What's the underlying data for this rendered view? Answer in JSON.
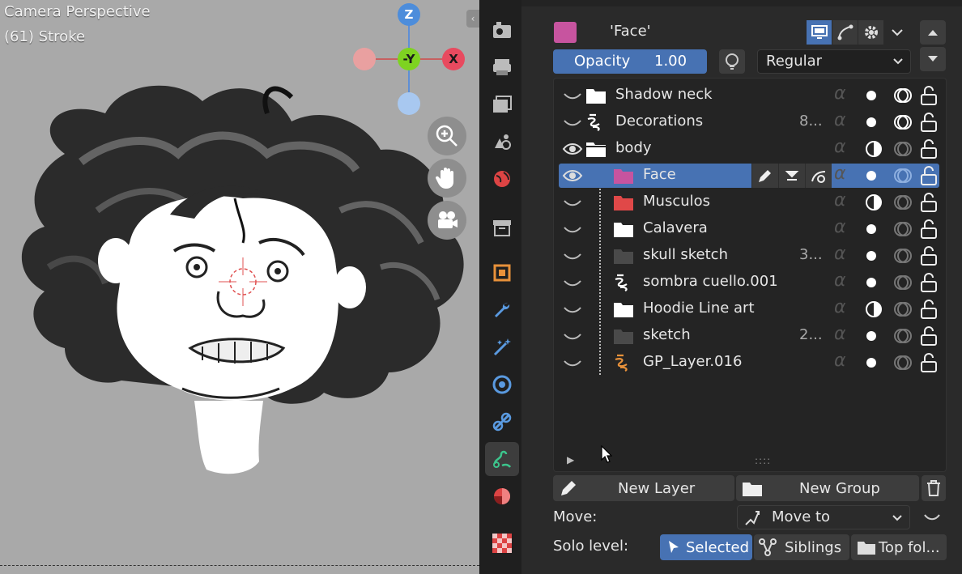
{
  "viewport": {
    "camera_title": "Camera Perspective",
    "frame_info": "(61) Stroke",
    "gizmo": {
      "z": "Z",
      "y": "-Y",
      "x": "X"
    },
    "nav_icons": [
      "zoom-in-icon",
      "hand-pan-icon",
      "camera-view-icon"
    ]
  },
  "tabs": [
    "render-icon",
    "output-icon",
    "view-layer-icon",
    "scene-icon",
    "world-icon",
    "collection-icon",
    "object-icon",
    "modifiers-icon",
    "shader-effects-icon",
    "physics-icon",
    "constraints-icon",
    "object-data-icon",
    "material-icon",
    "texture-icon"
  ],
  "active_tab": "object-data-icon",
  "panel": {
    "header_name": "'Face'",
    "opacity_label": "Opacity",
    "opacity_value": "1.00",
    "blend_mode": "Regular",
    "layers": [
      {
        "name": "Shadow neck",
        "ext": "",
        "type": "folder-white",
        "visible": false,
        "indent": 0
      },
      {
        "name": "Decorations",
        "ext": "8...",
        "type": "stroke-white",
        "visible": false,
        "indent": 0
      },
      {
        "name": "body",
        "ext": "",
        "type": "folder-open-white",
        "visible": true,
        "indent": 0
      },
      {
        "name": "Face",
        "ext": "",
        "type": "folder-pink",
        "visible": true,
        "indent": 1,
        "selected": true
      },
      {
        "name": "Musculos",
        "ext": "",
        "type": "folder-red",
        "visible": false,
        "indent": 1
      },
      {
        "name": "Calavera",
        "ext": "",
        "type": "folder-white",
        "visible": false,
        "indent": 1
      },
      {
        "name": "skull sketch",
        "ext": "3...",
        "type": "folder-gray",
        "visible": false,
        "indent": 1
      },
      {
        "name": "sombra cuello.001",
        "ext": "",
        "type": "stroke-white",
        "visible": false,
        "indent": 1
      },
      {
        "name": "Hoodie Line art",
        "ext": "",
        "type": "folder-white",
        "visible": false,
        "indent": 1
      },
      {
        "name": "sketch",
        "ext": "2...",
        "type": "folder-gray",
        "visible": false,
        "indent": 1
      },
      {
        "name": "GP_Layer.016",
        "ext": "",
        "type": "stroke-orange",
        "visible": false,
        "indent": 1
      }
    ],
    "new_layer": "New Layer",
    "new_group": "New Group",
    "move_label": "Move:",
    "move_to": "Move to",
    "solo_label": "Solo level:",
    "solo_selected": "Selected",
    "solo_siblings": "Siblings",
    "solo_top": "Top fol..."
  },
  "colors": {
    "accent": "#4772b3",
    "face_folder": "#c7549f",
    "musculos_folder": "#e04848",
    "stroke_orange": "#e8913a"
  }
}
